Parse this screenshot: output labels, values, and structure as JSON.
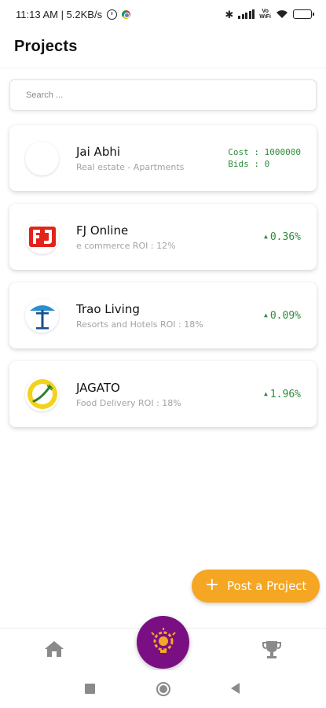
{
  "status_bar": {
    "time_speed": "11:13 AM | 5.2KB/s",
    "volte_line1": "Vo",
    "volte_line2": "WiFi"
  },
  "header": {
    "title": "Projects"
  },
  "search": {
    "placeholder": "Search ...",
    "value": ""
  },
  "projects": [
    {
      "name": "Jai Abhi",
      "subtitle": "Real estate - Apartments",
      "cost": "Cost : 1000000",
      "bids": "Bids : 0",
      "logo_icon": "blank-logo-icon"
    },
    {
      "name": "FJ Online",
      "subtitle": "e commerce ROI : 12%",
      "change": "0.36%",
      "logo_icon": "fj-logo-icon",
      "logo_color": "#e2231a"
    },
    {
      "name": "Trao Living",
      "subtitle": "Resorts and Hotels ROI : 18%",
      "change": "0.09%",
      "logo_icon": "trao-logo-icon",
      "logo_color": "#1a4e8c"
    },
    {
      "name": "JAGATO",
      "subtitle": "Food Delivery ROI : 18%",
      "change": "1.96%",
      "logo_icon": "jagato-logo-icon",
      "logo_color": "#f2d21b"
    }
  ],
  "post_button": {
    "label": "Post a Project",
    "color": "#f5a623"
  },
  "bottom_nav": {
    "items": [
      "home-icon",
      "idea-gear-icon",
      "trophy-icon"
    ],
    "center_color": "#7a0f83"
  },
  "colors": {
    "positive_green": "#2e8b3c",
    "muted_text": "#a3a3a3"
  }
}
